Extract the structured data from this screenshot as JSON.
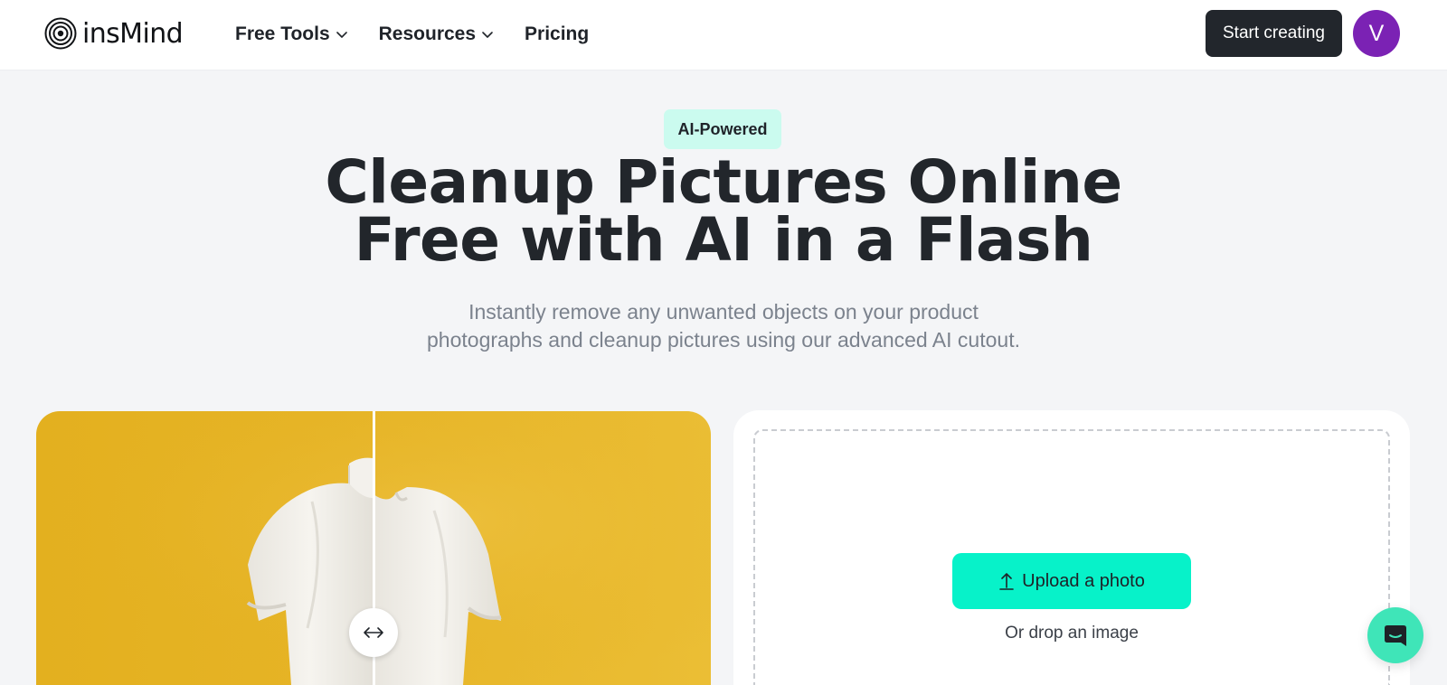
{
  "header": {
    "brand": "insMind",
    "nav": [
      {
        "label": "Free Tools",
        "has_dropdown": true
      },
      {
        "label": "Resources",
        "has_dropdown": true
      },
      {
        "label": "Pricing",
        "has_dropdown": false
      }
    ],
    "cta_label": "Start creating",
    "avatar_initial": "V",
    "avatar_color": "#7b22b4"
  },
  "hero": {
    "badge": "AI-Powered",
    "title_line1": "Cleanup Pictures Online",
    "title_line2": "Free with AI in a Flash",
    "subtitle_line1": "Instantly remove any unwanted objects on your product",
    "subtitle_line2": "photographs and cleanup pictures using our advanced AI cutout."
  },
  "preview": {
    "icon": "compare-arrows-icon",
    "background_color": "#e6b426"
  },
  "upload": {
    "button_label": "Upload a photo",
    "button_icon": "upload-arrow-icon",
    "drop_text": "Or drop an image",
    "accent_color": "#07f2c9"
  },
  "chat": {
    "icon": "chat-icon",
    "color": "#3fe5b8"
  }
}
